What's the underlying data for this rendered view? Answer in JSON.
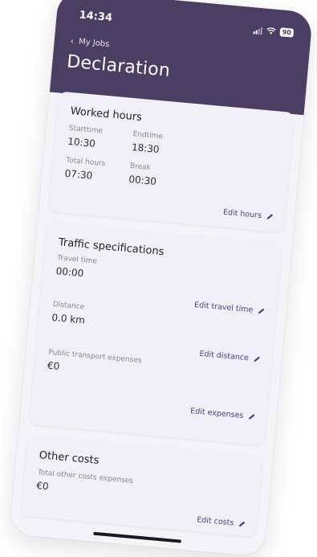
{
  "status_bar": {
    "time": "14:34",
    "battery": "90"
  },
  "nav": {
    "back_label": "My Jobs"
  },
  "page": {
    "title": "Declaration"
  },
  "worked_hours": {
    "title": "Worked hours",
    "starttime_label": "Starttime",
    "starttime_value": "10:30",
    "endtime_label": "Endtime",
    "endtime_value": "18:30",
    "total_hours_label": "Total hours",
    "total_hours_value": "07:30",
    "break_label": "Break",
    "break_value": "00:30",
    "edit_label": "Edit hours"
  },
  "traffic": {
    "title": "Traffic specifications",
    "travel_time_label": "Travel time",
    "travel_time_value": "00:00",
    "edit_travel_time_label": "Edit travel time",
    "distance_label": "Distance",
    "distance_value": "0.0 km",
    "edit_distance_label": "Edit distance",
    "public_transport_label": "Public transport expenses",
    "public_transport_value": "€0",
    "edit_expenses_label": "Edit expenses"
  },
  "other_costs": {
    "title": "Other costs",
    "total_label": "Total other costs expenses",
    "total_value": "€0",
    "edit_label": "Edit costs"
  },
  "colors": {
    "header_bg": "#4a3f63",
    "accent": "#4a3f88",
    "card_bg": "#f1eff8"
  }
}
